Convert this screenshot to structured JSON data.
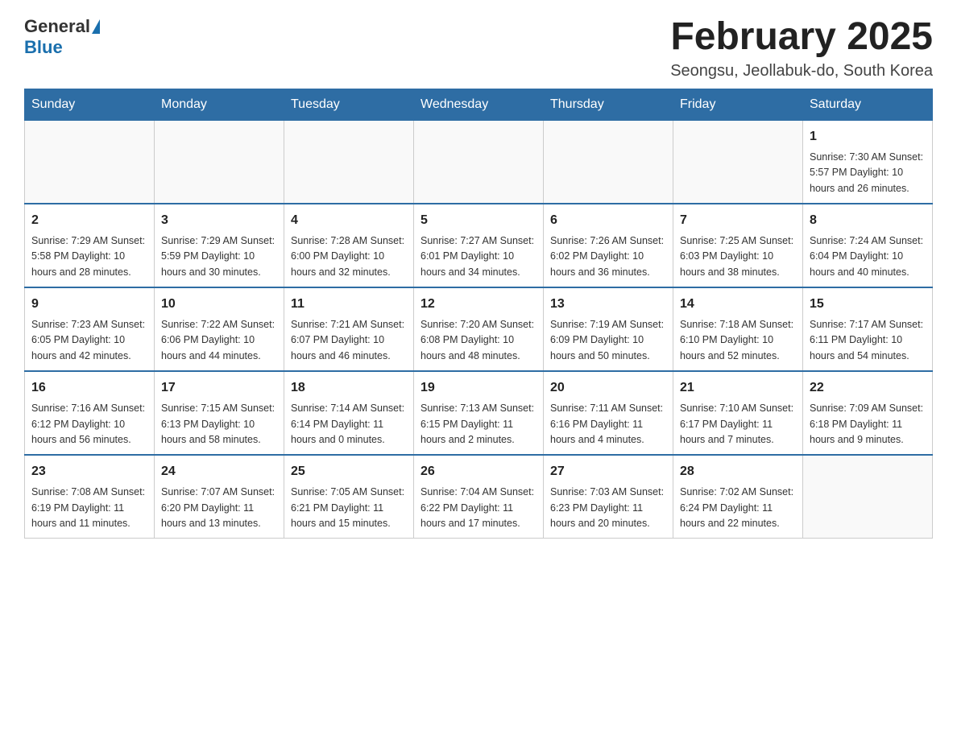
{
  "logo": {
    "general": "General",
    "blue": "Blue"
  },
  "title": "February 2025",
  "subtitle": "Seongsu, Jeollabuk-do, South Korea",
  "headers": [
    "Sunday",
    "Monday",
    "Tuesday",
    "Wednesday",
    "Thursday",
    "Friday",
    "Saturday"
  ],
  "weeks": [
    [
      {
        "day": "",
        "info": ""
      },
      {
        "day": "",
        "info": ""
      },
      {
        "day": "",
        "info": ""
      },
      {
        "day": "",
        "info": ""
      },
      {
        "day": "",
        "info": ""
      },
      {
        "day": "",
        "info": ""
      },
      {
        "day": "1",
        "info": "Sunrise: 7:30 AM\nSunset: 5:57 PM\nDaylight: 10 hours and 26 minutes."
      }
    ],
    [
      {
        "day": "2",
        "info": "Sunrise: 7:29 AM\nSunset: 5:58 PM\nDaylight: 10 hours and 28 minutes."
      },
      {
        "day": "3",
        "info": "Sunrise: 7:29 AM\nSunset: 5:59 PM\nDaylight: 10 hours and 30 minutes."
      },
      {
        "day": "4",
        "info": "Sunrise: 7:28 AM\nSunset: 6:00 PM\nDaylight: 10 hours and 32 minutes."
      },
      {
        "day": "5",
        "info": "Sunrise: 7:27 AM\nSunset: 6:01 PM\nDaylight: 10 hours and 34 minutes."
      },
      {
        "day": "6",
        "info": "Sunrise: 7:26 AM\nSunset: 6:02 PM\nDaylight: 10 hours and 36 minutes."
      },
      {
        "day": "7",
        "info": "Sunrise: 7:25 AM\nSunset: 6:03 PM\nDaylight: 10 hours and 38 minutes."
      },
      {
        "day": "8",
        "info": "Sunrise: 7:24 AM\nSunset: 6:04 PM\nDaylight: 10 hours and 40 minutes."
      }
    ],
    [
      {
        "day": "9",
        "info": "Sunrise: 7:23 AM\nSunset: 6:05 PM\nDaylight: 10 hours and 42 minutes."
      },
      {
        "day": "10",
        "info": "Sunrise: 7:22 AM\nSunset: 6:06 PM\nDaylight: 10 hours and 44 minutes."
      },
      {
        "day": "11",
        "info": "Sunrise: 7:21 AM\nSunset: 6:07 PM\nDaylight: 10 hours and 46 minutes."
      },
      {
        "day": "12",
        "info": "Sunrise: 7:20 AM\nSunset: 6:08 PM\nDaylight: 10 hours and 48 minutes."
      },
      {
        "day": "13",
        "info": "Sunrise: 7:19 AM\nSunset: 6:09 PM\nDaylight: 10 hours and 50 minutes."
      },
      {
        "day": "14",
        "info": "Sunrise: 7:18 AM\nSunset: 6:10 PM\nDaylight: 10 hours and 52 minutes."
      },
      {
        "day": "15",
        "info": "Sunrise: 7:17 AM\nSunset: 6:11 PM\nDaylight: 10 hours and 54 minutes."
      }
    ],
    [
      {
        "day": "16",
        "info": "Sunrise: 7:16 AM\nSunset: 6:12 PM\nDaylight: 10 hours and 56 minutes."
      },
      {
        "day": "17",
        "info": "Sunrise: 7:15 AM\nSunset: 6:13 PM\nDaylight: 10 hours and 58 minutes."
      },
      {
        "day": "18",
        "info": "Sunrise: 7:14 AM\nSunset: 6:14 PM\nDaylight: 11 hours and 0 minutes."
      },
      {
        "day": "19",
        "info": "Sunrise: 7:13 AM\nSunset: 6:15 PM\nDaylight: 11 hours and 2 minutes."
      },
      {
        "day": "20",
        "info": "Sunrise: 7:11 AM\nSunset: 6:16 PM\nDaylight: 11 hours and 4 minutes."
      },
      {
        "day": "21",
        "info": "Sunrise: 7:10 AM\nSunset: 6:17 PM\nDaylight: 11 hours and 7 minutes."
      },
      {
        "day": "22",
        "info": "Sunrise: 7:09 AM\nSunset: 6:18 PM\nDaylight: 11 hours and 9 minutes."
      }
    ],
    [
      {
        "day": "23",
        "info": "Sunrise: 7:08 AM\nSunset: 6:19 PM\nDaylight: 11 hours and 11 minutes."
      },
      {
        "day": "24",
        "info": "Sunrise: 7:07 AM\nSunset: 6:20 PM\nDaylight: 11 hours and 13 minutes."
      },
      {
        "day": "25",
        "info": "Sunrise: 7:05 AM\nSunset: 6:21 PM\nDaylight: 11 hours and 15 minutes."
      },
      {
        "day": "26",
        "info": "Sunrise: 7:04 AM\nSunset: 6:22 PM\nDaylight: 11 hours and 17 minutes."
      },
      {
        "day": "27",
        "info": "Sunrise: 7:03 AM\nSunset: 6:23 PM\nDaylight: 11 hours and 20 minutes."
      },
      {
        "day": "28",
        "info": "Sunrise: 7:02 AM\nSunset: 6:24 PM\nDaylight: 11 hours and 22 minutes."
      },
      {
        "day": "",
        "info": ""
      }
    ]
  ]
}
